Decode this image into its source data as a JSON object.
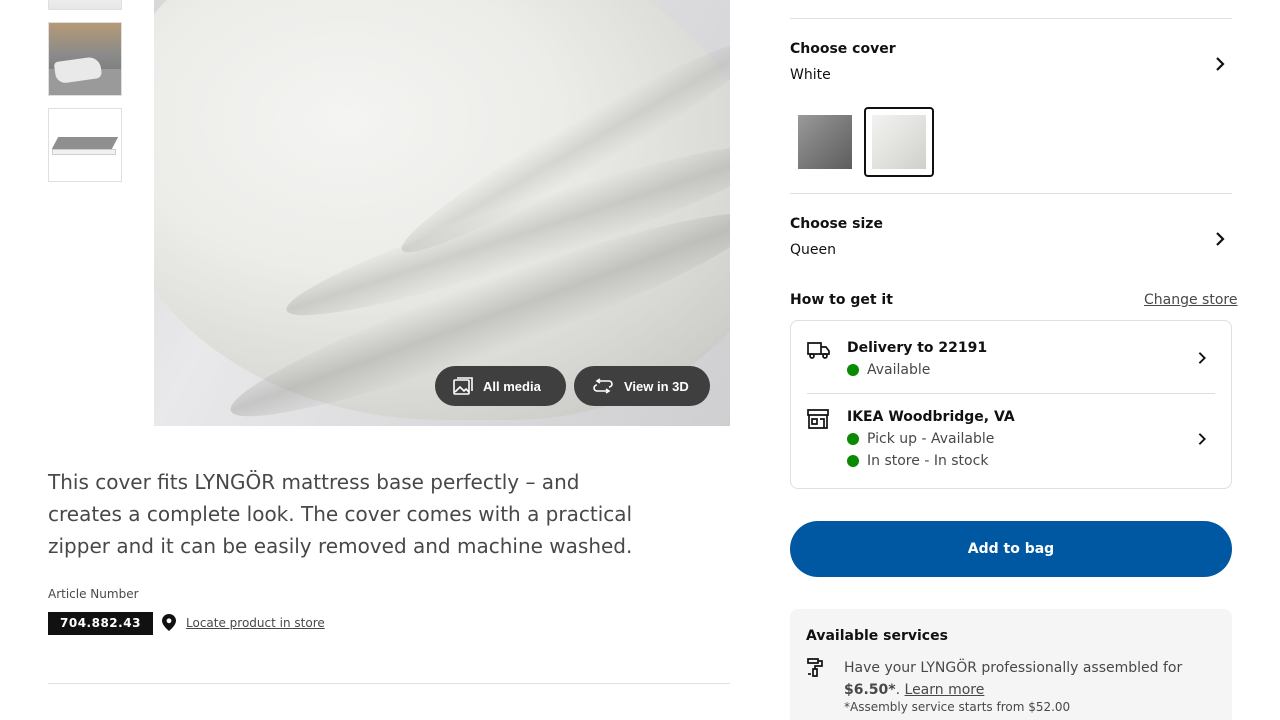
{
  "media": {
    "all_media_label": "All media",
    "view_3d_label": "View in 3D"
  },
  "description": "This cover fits LYNGÖR mattress base perfectly – and creates a complete look. The cover comes with a practical zipper and it can be easily removed and machine washed.",
  "article": {
    "label": "Article Number",
    "number": "704.882.43",
    "locate_label": "Locate product in store"
  },
  "cover": {
    "title": "Choose cover",
    "value": "White",
    "swatches": [
      {
        "name": "Grey",
        "selected": false,
        "color": "#7a7a7a"
      },
      {
        "name": "White",
        "selected": true,
        "color": "#e6e6e3"
      }
    ]
  },
  "size": {
    "title": "Choose size",
    "value": "Queen"
  },
  "how_to_get": {
    "title": "How to get it",
    "change_store_label": "Change store",
    "delivery": {
      "title": "Delivery to 22191",
      "status": "Available"
    },
    "store": {
      "title": "IKEA Woodbridge, VA",
      "pickup_status": "Pick up - Available",
      "instore_status": "In store - In stock"
    }
  },
  "add_to_bag_label": "Add to bag",
  "services": {
    "title": "Available services",
    "text_prefix": "Have your LYNGÖR professionally assembled for ",
    "price": "$6.50*",
    "separator": ". ",
    "learn_more": "Learn more",
    "note": "*Assembly service starts from $52.00"
  },
  "colors": {
    "primary_blue": "#0058a3",
    "available_green": "#0a8a00",
    "dark_button": "#3f3f3f",
    "text_secondary": "#484848"
  }
}
